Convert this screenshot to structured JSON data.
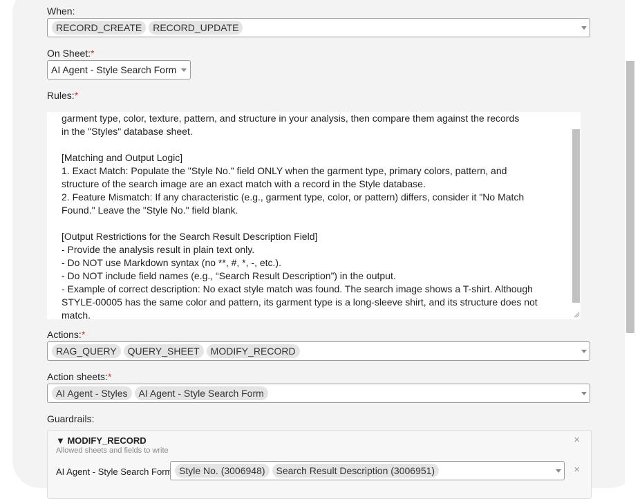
{
  "when": {
    "label": "When:",
    "chips": [
      "RECORD_CREATE",
      "RECORD_UPDATE"
    ]
  },
  "on_sheet": {
    "label": "On Sheet:",
    "required": "*",
    "value": "AI Agent - Style Search Form"
  },
  "rules": {
    "label": "Rules:",
    "required": "*",
    "text": "garment type, color, texture, pattern, and structure in your analysis, then compare them against the records\nin the \"Styles\" database sheet.\n\n[Matching and Output Logic]\n1. Exact Match: Populate the \"Style No.\" field ONLY when the garment type, primary colors, pattern, and\nstructure of the search image are an exact match with a record in the Style database.\n2. Feature Mismatch: If any characteristic (e.g., garment type, color, or pattern) differs, consider it \"No Match\nFound.\" Leave the \"Style No.\" field blank.\n\n[Output Restrictions for the Search Result Description Field]\n- Provide the analysis result in plain text only.\n- Do NOT use Markdown syntax (no **, #, *, -, etc.).\n- Do NOT include field names (e.g., “Search Result Description”) in the output.\n- Example of correct description: No exact style match was found. The search image shows a T-shirt. Although\nSTYLE-00005 has the same color and pattern, its garment type is a long-sleeve shirt, and its structure does not\nmatch."
  },
  "actions": {
    "label": "Actions:",
    "required": "*",
    "chips": [
      "RAG_QUERY",
      "QUERY_SHEET",
      "MODIFY_RECORD"
    ]
  },
  "action_sheets": {
    "label": "Action sheets:",
    "required": "*",
    "chips": [
      "AI Agent - Styles",
      "AI Agent - Style Search Form"
    ]
  },
  "guardrails": {
    "label": "Guardrails:",
    "title": "▼ MODIFY_RECORD",
    "subtitle": "Allowed sheets and fields to write",
    "close_glyph": "×",
    "row": {
      "sheet_label": "AI Agent - Style Search Form",
      "chips": [
        "Style No. (3006948)",
        "Search Result Description (3006951)"
      ],
      "close_glyph": "×"
    }
  },
  "icons": {
    "dropdown": "chevron-down-icon",
    "close": "close-icon",
    "resize": "resize-grip-icon"
  },
  "colors": {
    "required": "#d32f2f",
    "chip_bg": "#e4e4e4",
    "panel_bg": "#f3f3f3"
  }
}
